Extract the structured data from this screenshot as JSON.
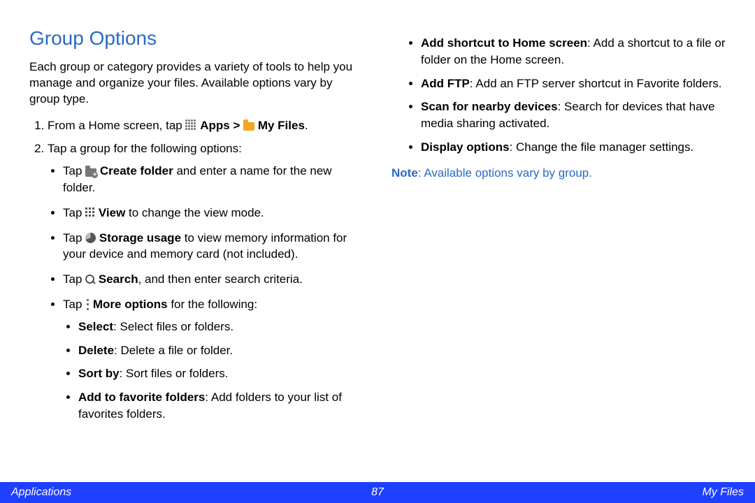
{
  "heading": "Group Options",
  "intro": "Each group or category provides a variety of tools to help you manage and organize your files. Available options vary by group type.",
  "step1": {
    "prefix": "From a Home screen, tap ",
    "appsLabel": "Apps",
    "gt": " > ",
    "myFiles": "My Files",
    "suffix": "."
  },
  "step2": "Tap a group for the following options:",
  "bullets": {
    "tap": "Tap ",
    "createFolder": {
      "label": "Create folder",
      "rest": " and enter a name for the new folder."
    },
    "view": {
      "label": "View",
      "rest": " to change the view mode."
    },
    "storage": {
      "label": "Storage usage",
      "rest": " to view memory information for your device and memory card (not included)."
    },
    "search": {
      "label": "Search",
      "rest": ", and then enter search criteria."
    },
    "moreOptions": {
      "label": "More options",
      "rest": " for the following:"
    },
    "sub": {
      "select": {
        "label": "Select",
        "rest": ": Select files or folders."
      },
      "delete": {
        "label": "Delete",
        "rest": ": Delete a file or folder."
      },
      "sortby": {
        "label": "Sort by",
        "rest": ": Sort files or folders."
      },
      "fav": {
        "label": "Add to favorite folders",
        "rest": ": Add folders to your list of favorites folders."
      },
      "home": {
        "label": "Add shortcut to Home screen",
        "rest": ": Add a shortcut to a file or folder on the Home screen."
      },
      "ftp": {
        "label": "Add FTP",
        "rest": ": Add an FTP server shortcut in Favorite folders."
      },
      "scan": {
        "label": "Scan for nearby devices",
        "rest": ": Search for devices that have media sharing activated."
      },
      "disp": {
        "label": "Display options",
        "rest": ": Change the file manager settings."
      }
    }
  },
  "note": {
    "label": "Note",
    "rest": ": Available options vary by group."
  },
  "footer": {
    "left": "Applications",
    "center": "87",
    "right": "My Files"
  }
}
